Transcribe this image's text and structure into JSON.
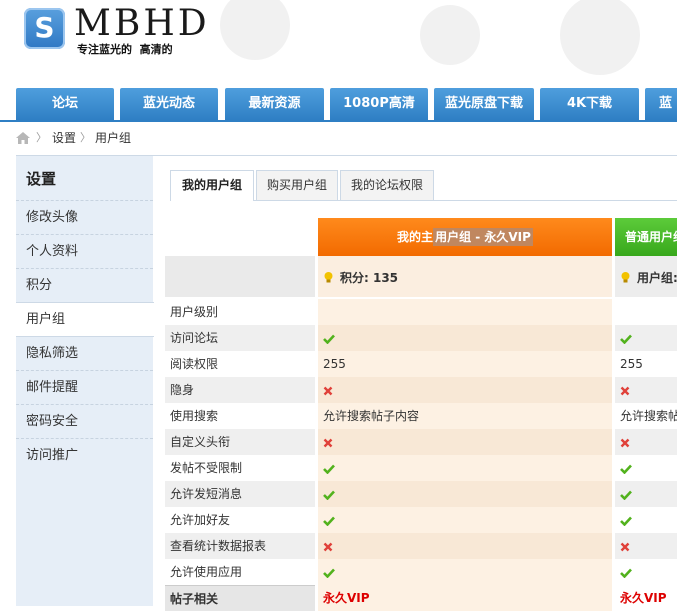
{
  "header": {
    "logo_letter": "S",
    "site_name": "MBHD",
    "slogan": "专注蓝光的  高清的"
  },
  "nav": {
    "items": [
      "论坛",
      "蓝光动态",
      "最新资源",
      "1080P高清",
      "蓝光原盘下载",
      "4K下载",
      "蓝"
    ]
  },
  "breadcrumb": {
    "items": [
      "设置",
      "用户组"
    ],
    "separator": "〉"
  },
  "sidebar": {
    "title": "设置",
    "items": [
      "修改头像",
      "个人资料",
      "积分",
      "用户组",
      "隐私筛选",
      "邮件提醒",
      "密码安全",
      "访问推广"
    ],
    "active": "用户组"
  },
  "tabs": {
    "items": [
      "我的用户组",
      "购买用户组",
      "我的论坛权限"
    ],
    "active": "我的用户组"
  },
  "groups": {
    "vip": {
      "title_pre": "我的主",
      "title_hl": "用户组 - 永久VIP",
      "sub": "积分: 135",
      "color": "#f27a0a"
    },
    "normal": {
      "title": "普通用户组",
      "sub": "用户组:",
      "color": "#44b424"
    }
  },
  "permissions": {
    "rows": [
      {
        "label": "用户级别",
        "vip": "",
        "normal": ""
      },
      {
        "label": "访问论坛",
        "vip": "check-icon",
        "normal": "check-icon"
      },
      {
        "label": "阅读权限",
        "vip": "255",
        "normal": "255"
      },
      {
        "label": "隐身",
        "vip": "cross-icon",
        "normal": "cross-icon"
      },
      {
        "label": "使用搜索",
        "vip": "允许搜索帖子内容",
        "normal": "允许搜索帖"
      },
      {
        "label": "自定义头衔",
        "vip": "cross-icon",
        "normal": "cross-icon"
      },
      {
        "label": "发帖不受限制",
        "vip": "check-icon",
        "normal": "check-icon"
      },
      {
        "label": "允许发短消息",
        "vip": "check-icon",
        "normal": "check-icon"
      },
      {
        "label": "允许加好友",
        "vip": "check-icon",
        "normal": "check-icon"
      },
      {
        "label": "查看统计数据报表",
        "vip": "cross-icon",
        "normal": "cross-icon"
      },
      {
        "label": "允许使用应用",
        "vip": "check-icon",
        "normal": "check-icon"
      }
    ],
    "section": {
      "label": "帖子相关",
      "vip": "永久VIP",
      "normal": "永久VIP"
    }
  },
  "colors": {
    "nav_blue": "#2f7fc4",
    "check_green": "#52b21d",
    "cross_red": "#e0413a"
  }
}
